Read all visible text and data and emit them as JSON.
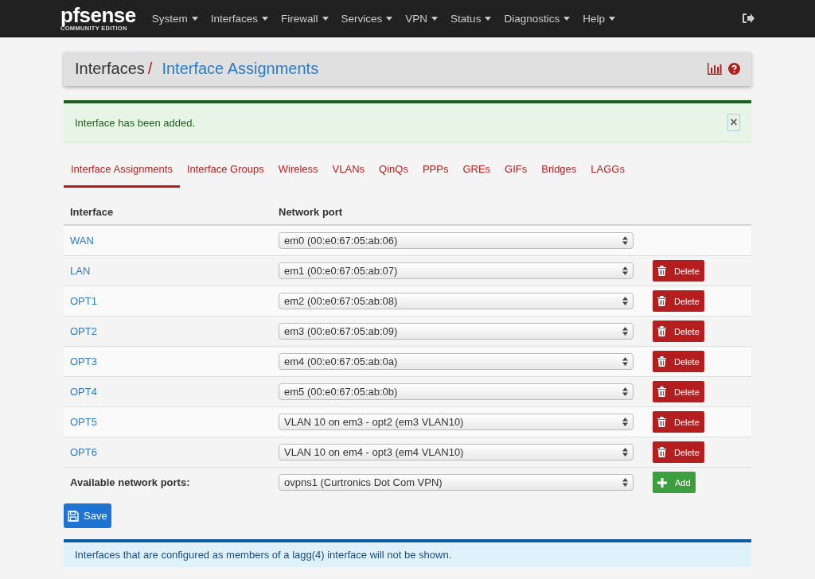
{
  "brand": {
    "logo": "pfsense",
    "edition": "COMMUNITY EDITION"
  },
  "menu": [
    "System",
    "Interfaces",
    "Firewall",
    "Services",
    "VPN",
    "Status",
    "Diagnostics",
    "Help"
  ],
  "breadcrumb": {
    "parent": "Interfaces",
    "separator": "/",
    "current": "Interface Assignments"
  },
  "alert": {
    "message": "Interface has been added.",
    "close": "×"
  },
  "tabs": [
    {
      "label": "Interface Assignments",
      "selected": true
    },
    {
      "label": "Interface Groups",
      "selected": false
    },
    {
      "label": "Wireless",
      "selected": false
    },
    {
      "label": "VLANs",
      "selected": false
    },
    {
      "label": "QinQs",
      "selected": false
    },
    {
      "label": "PPPs",
      "selected": false
    },
    {
      "label": "GREs",
      "selected": false
    },
    {
      "label": "GIFs",
      "selected": false
    },
    {
      "label": "Bridges",
      "selected": false
    },
    {
      "label": "LAGGs",
      "selected": false
    }
  ],
  "table": {
    "columns": [
      "Interface",
      "Network port"
    ],
    "rows": [
      {
        "interface": "WAN",
        "port": "em0 (00:e0:67:05:ab:06)"
      },
      {
        "interface": "LAN",
        "port": "em1 (00:e0:67:05:ab:07)",
        "delete_button": "Delete"
      },
      {
        "interface": "OPT1",
        "port": "em2 (00:e0:67:05:ab:08)",
        "delete_button": "Delete"
      },
      {
        "interface": "OPT2",
        "port": "em3 (00:e0:67:05:ab:09)",
        "delete_button": "Delete"
      },
      {
        "interface": "OPT3",
        "port": "em4 (00:e0:67:05:ab:0a)",
        "delete_button": "Delete"
      },
      {
        "interface": "OPT4",
        "port": "em5 (00:e0:67:05:ab:0b)",
        "delete_button": "Delete"
      },
      {
        "interface": "OPT5",
        "port": "VLAN 10 on em3 - opt2 (em3 VLAN10)",
        "delete_button": "Delete"
      },
      {
        "interface": "OPT6",
        "port": "VLAN 10 on em4 - opt3 (em4 VLAN10)",
        "delete_button": "Delete"
      }
    ],
    "available": {
      "label": "Available network ports:",
      "port": "ovpns1 (Curtronics Dot Com VPN)",
      "button": "Add"
    }
  },
  "save_button": "Save",
  "info": "Interfaces that are configured as members of a lagg(4) interface will not be shown."
}
